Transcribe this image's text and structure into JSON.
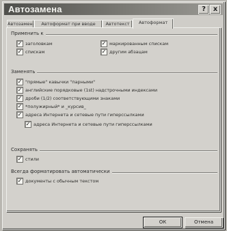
{
  "window": {
    "title": "Автозамена",
    "help_glyph": "?",
    "close_glyph": "x"
  },
  "tabs": [
    {
      "label": "Автозамена",
      "active": false
    },
    {
      "label": "Автоформат при вводе",
      "active": false
    },
    {
      "label": "Автотекст",
      "active": false
    },
    {
      "label": "Автоформат",
      "active": true
    }
  ],
  "apply": {
    "legend": "Применить к",
    "items": [
      {
        "label": "заголовкам",
        "checked": true
      },
      {
        "label": "спискам",
        "checked": true
      },
      {
        "label": "маркированным спискам",
        "checked": true
      },
      {
        "label": "другим абзацам",
        "checked": true
      }
    ]
  },
  "replace": {
    "legend": "Заменять",
    "items": [
      {
        "label": "\"прямые\" кавычки \"парными\"",
        "checked": true
      },
      {
        "label": "английские порядковые (1st) надстрочными индексами",
        "checked": true
      },
      {
        "label": "дроби (1/2) соответствующими знаками",
        "checked": true
      },
      {
        "label": "*полужирный* и _курсив_",
        "checked": true
      },
      {
        "label": "адреса Интернета и сетевые пути гиперссылками",
        "checked": true
      },
      {
        "label": "адреса Интернета и сетевые пути гиперссылками",
        "checked": true
      }
    ]
  },
  "preserve": {
    "legend": "Сохранять",
    "items": [
      {
        "label": "стили",
        "checked": true
      }
    ]
  },
  "always_format": {
    "legend": "Всегда форматировать автоматически",
    "items": [
      {
        "label": "документы с обычным текстом",
        "checked": true
      }
    ]
  },
  "buttons": {
    "ok": "ОК",
    "cancel": "Отмена"
  }
}
